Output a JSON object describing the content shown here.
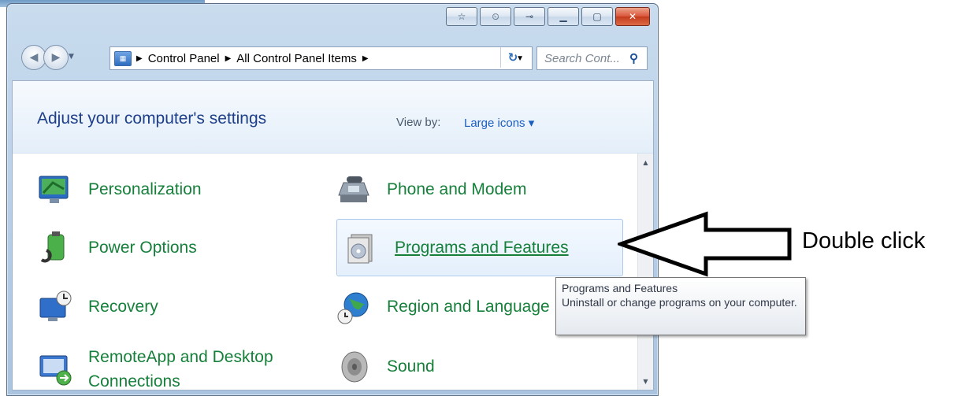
{
  "window": {
    "caption_buttons": [
      {
        "name": "favorite-button",
        "icon": "star-icon",
        "glyph": "☆"
      },
      {
        "name": "recent-button",
        "icon": "clock-folder-icon",
        "glyph": "⏲"
      },
      {
        "name": "connect-button",
        "icon": "plug-icon",
        "glyph": "⊸"
      },
      {
        "name": "minimize-button",
        "icon": "minimize-icon",
        "glyph": "▁"
      },
      {
        "name": "maximize-button",
        "icon": "maximize-icon",
        "glyph": "▢"
      },
      {
        "name": "close-button",
        "icon": "close-icon",
        "glyph": "✕"
      }
    ]
  },
  "nav": {
    "back_glyph": "◀",
    "forward_glyph": "▶",
    "history_glyph": "▼",
    "breadcrumb": [
      "Control Panel",
      "All Control Panel Items"
    ],
    "address_icon": "control-panel-icon",
    "address_icon_glyph": "▦",
    "sep_glyph": "▶",
    "dropdown_glyph": "▼",
    "refresh_glyph": "↻",
    "search_placeholder": "Search Cont...",
    "search_glyph": "⚲"
  },
  "header": {
    "title": "Adjust your computer's settings",
    "view_by_label": "View by:",
    "view_by_value": "Large icons ▾"
  },
  "items": [
    {
      "label": "Personalization",
      "icon": "personalization-icon"
    },
    {
      "label": "Phone and Modem",
      "icon": "phone-modem-icon"
    },
    {
      "label": "Power Options",
      "icon": "power-options-icon"
    },
    {
      "label": "Programs and Features",
      "icon": "programs-features-icon"
    },
    {
      "label": "Recovery",
      "icon": "recovery-icon"
    },
    {
      "label": "Region and Language",
      "icon": "region-language-icon"
    },
    {
      "label_lines": [
        "RemoteApp and Desktop",
        "Connections"
      ],
      "icon": "remoteapp-icon"
    },
    {
      "label": "Sound",
      "icon": "sound-icon"
    }
  ],
  "scrollbar": {
    "up_glyph": "▲",
    "down_glyph": "▼"
  },
  "tooltip": {
    "title": "Programs and Features",
    "description": "Uninstall or change programs on your computer."
  },
  "annotation": {
    "text": "Double click",
    "icon": "arrow-left-icon"
  },
  "colors": {
    "item_green": "#16803b",
    "title_blue": "#1e3f8a",
    "link_blue": "#1b5ec0"
  }
}
